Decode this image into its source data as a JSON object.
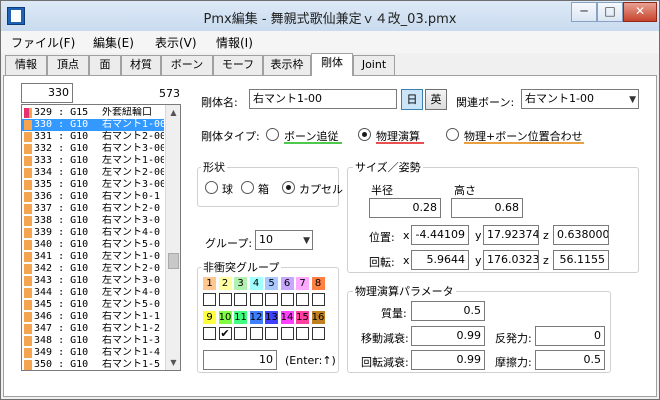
{
  "window": {
    "title": "Pmx編集 - 舞親式歌仙兼定ｖ４改_03.pmx",
    "minimize": "─",
    "maximize": "□",
    "close": "✕"
  },
  "menu": [
    "ファイル(F)",
    "編集(E)",
    "表示(V)",
    "情報(I)"
  ],
  "tabs": [
    "情報",
    "頂点",
    "面",
    "材質",
    "ボーン",
    "モーフ",
    "表示枠",
    "剛体",
    "Joint"
  ],
  "list": {
    "selected_index_value": "330",
    "total": "573",
    "rows": [
      {
        "label": "329 : G15",
        "name": "外套紐輪口",
        "sw": "#e8306e",
        "sw2": "#f5a550"
      },
      {
        "label": "330 : G10",
        "name": "右マント1-00",
        "sw": "#f5a550",
        "sw2": "#f5a550",
        "selected": true
      },
      {
        "label": "331 : G10",
        "name": "右マント2-00",
        "sw": "#f5a550",
        "sw2": "#f5a550"
      },
      {
        "label": "332 : G10",
        "name": "右マント3-00",
        "sw": "#f5a550",
        "sw2": "#f5a550"
      },
      {
        "label": "333 : G10",
        "name": "左マント1-00",
        "sw": "#f5a550",
        "sw2": "#f5a550"
      },
      {
        "label": "334 : G10",
        "name": "左マント2-00",
        "sw": "#f5a550",
        "sw2": "#f5a550"
      },
      {
        "label": "335 : G10",
        "name": "左マント3-00",
        "sw": "#f5a550",
        "sw2": "#f5a550"
      },
      {
        "label": "336 : G10",
        "name": "右マント0-1",
        "sw": "#f5a550",
        "sw2": "#f5a550"
      },
      {
        "label": "337 : G10",
        "name": "右マント2-0",
        "sw": "#f5a550",
        "sw2": "#f5a550"
      },
      {
        "label": "338 : G10",
        "name": "右マント3-0",
        "sw": "#f5a550",
        "sw2": "#f5a550"
      },
      {
        "label": "339 : G10",
        "name": "右マント4-0",
        "sw": "#f5a550",
        "sw2": "#f5a550"
      },
      {
        "label": "340 : G10",
        "name": "右マント5-0",
        "sw": "#f5a550",
        "sw2": "#f5a550"
      },
      {
        "label": "341 : G10",
        "name": "左マント1-0",
        "sw": "#f5a550",
        "sw2": "#f5a550"
      },
      {
        "label": "342 : G10",
        "name": "左マント2-0",
        "sw": "#f5a550",
        "sw2": "#f5a550"
      },
      {
        "label": "343 : G10",
        "name": "左マント3-0",
        "sw": "#f5a550",
        "sw2": "#f5a550"
      },
      {
        "label": "344 : G10",
        "name": "左マント4-0",
        "sw": "#f5a550",
        "sw2": "#f5a550"
      },
      {
        "label": "345 : G10",
        "name": "左マント5-0",
        "sw": "#f5a550",
        "sw2": "#f5a550"
      },
      {
        "label": "346 : G10",
        "name": "右マント1-1",
        "sw": "#f5a550",
        "sw2": "#f5a550"
      },
      {
        "label": "347 : G10",
        "name": "右マント1-2",
        "sw": "#f5a550",
        "sw2": "#f5a550"
      },
      {
        "label": "348 : G10",
        "name": "右マント1-3",
        "sw": "#f5a550",
        "sw2": "#f5a550"
      },
      {
        "label": "349 : G10",
        "name": "右マント1-4",
        "sw": "#f5a550",
        "sw2": "#f5a550"
      },
      {
        "label": "350 : G10",
        "name": "右マント1-5",
        "sw": "#f5a550",
        "sw2": "#f5a550"
      }
    ]
  },
  "rigid": {
    "name_label": "剛体名:",
    "name_value": "右マント1-00",
    "lang_jp": "日",
    "lang_en": "英",
    "bone_label": "関連ボーン:",
    "bone_value": "右マント1-00",
    "type_label": "剛体タイプ:",
    "type_options": [
      "ボーン追従",
      "物理演算",
      "物理+ボーン位置合わせ"
    ],
    "type_selected": 1,
    "type_colors": [
      "#4ec94e",
      "#e85050",
      "#e8a040"
    ]
  },
  "shape": {
    "title": "形状",
    "options": [
      "球",
      "箱",
      "カプセル"
    ],
    "selected": 2
  },
  "size": {
    "title": "サイズ／姿勢",
    "radius_label": "半径",
    "height_label": "高さ",
    "radius": "0.28",
    "height": "0.68",
    "pos_label": "位置:",
    "rot_label": "回転:",
    "x": "x",
    "y": "y",
    "z": "z",
    "pos": [
      "-4.44109",
      "17.92374",
      "0.638000"
    ],
    "rot": [
      "5.9644",
      "176.0323",
      "56.1155"
    ]
  },
  "group": {
    "label": "グループ:",
    "value": "10"
  },
  "nocollide": {
    "title": "非衝突グループ",
    "numbers": [
      "1",
      "2",
      "3",
      "4",
      "5",
      "6",
      "7",
      "8",
      "9",
      "10",
      "11",
      "12",
      "13",
      "14",
      "15",
      "16"
    ],
    "colors": [
      "#ffc890",
      "#ffffa0",
      "#b0f0b0",
      "#a0ffff",
      "#a8c8ff",
      "#c8a8ff",
      "#ffa8ff",
      "#ff8040",
      "#ffff40",
      "#80ff40",
      "#40ff80",
      "#4080ff",
      "#4040ff",
      "#ff40ff",
      "#ff40a0",
      "#c08020"
    ],
    "checked": [
      10
    ],
    "input_value": "10",
    "hint": "(Enter:↑)"
  },
  "physics": {
    "title": "物理演算パラメータ",
    "mass_label": "質量:",
    "mass": "0.5",
    "move_label": "移動減衰:",
    "move": "0.99",
    "rot_label": "回転減衰:",
    "rot": "0.99",
    "rest_label": "反発力:",
    "rest": "0",
    "fric_label": "摩擦力:",
    "fric": "0.5"
  }
}
